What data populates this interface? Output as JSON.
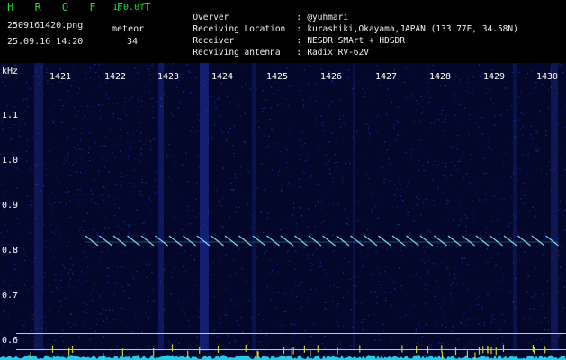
{
  "header": {
    "app_title": "H R O F F T",
    "version": "1.0.0f",
    "filename": "2509161420.png",
    "datetime": "25.09.16 14:20",
    "meteor_label": "meteor",
    "meteor_count": "34"
  },
  "info": [
    {
      "key": "Overver",
      "value": "@yuhmari"
    },
    {
      "key": "Receiving Location",
      "value": "kurashiki,Okayama,JAPAN (133.77E, 34.58N)"
    },
    {
      "key": "Receiver",
      "value": "NESDR SMArt + HDSDR"
    },
    {
      "key": "Recviving antenna",
      "value": "Radix RV-62V"
    }
  ],
  "spectrogram": {
    "y_unit": "kHz",
    "y_labels": [
      "1.1",
      "1.0",
      "0.9",
      "0.8",
      "0.7",
      "0.6"
    ],
    "time_labels": [
      "1421",
      "1422",
      "1423",
      "1424",
      "1425",
      "1426",
      "1427",
      "1428",
      "1429",
      "1430"
    ],
    "colors": {
      "background": "#03082a",
      "noise": "#2a3ccf",
      "echo": "#7ff0ff",
      "baseline": "#27c8e8",
      "spike": "#e0e040"
    }
  }
}
